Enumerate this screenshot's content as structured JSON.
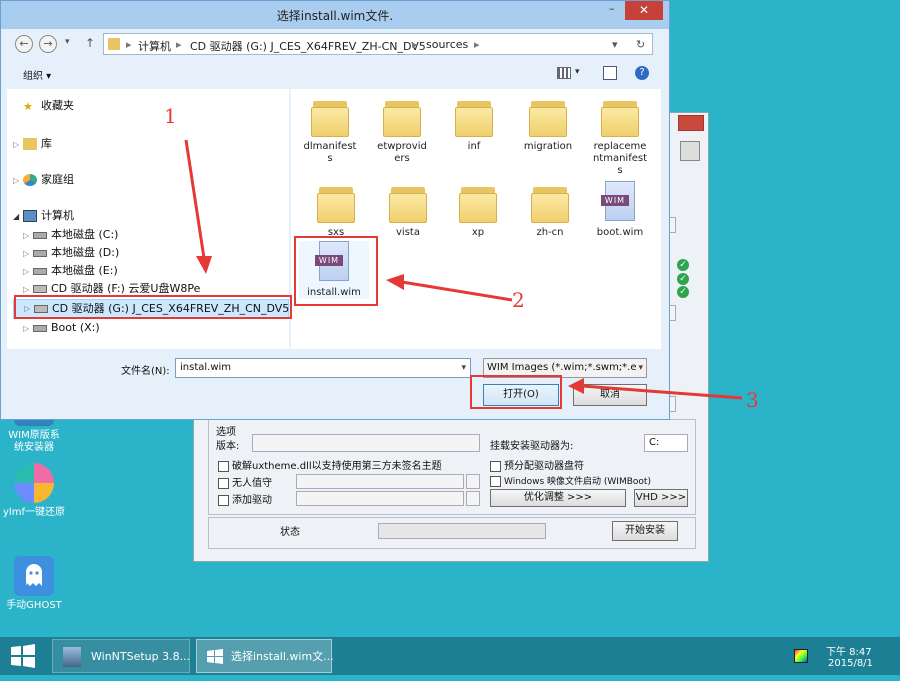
{
  "desktop": {
    "icons": [
      {
        "label_lines": [
          "WIM原版系",
          "统安装器"
        ]
      },
      {
        "label": "ylmf一键还原"
      },
      {
        "label": "手动GHOST"
      }
    ]
  },
  "setup_window": {
    "options_label": "选项",
    "version_label": "版本:",
    "cb1": "破解uxtheme.dll以支持使用第三方未签名主题",
    "cb2": "无人值守",
    "cb3": "添加驱动",
    "mount_label": "挂载安装驱动器为:",
    "mount_value": "C:",
    "cb4": "预分配驱动器盘符",
    "cb5": "Windows 映像文件启动 (WIMBoot)",
    "optimize_button": "优化调整 >>>",
    "vhd_button": "VHD >>>",
    "status_label": "状态",
    "install_button": "开始安装"
  },
  "dialog": {
    "title": "选择install.wim文件.",
    "close_glyph": "✕",
    "minimize_glyph": "–",
    "back_glyph": "←",
    "forward_glyph": "→",
    "dropdown_glyph": "▾",
    "up_glyph": "↑",
    "refresh_glyph": "↻",
    "breadcrumb": [
      "计算机",
      "CD 驱动器 (G:) J_CES_X64FREV_ZH-CN_DV5",
      "sources"
    ],
    "organize_label": "组织 ▾",
    "nav_items": [
      {
        "label": "收藏夹",
        "icon": "star-icon"
      },
      {
        "label": "库",
        "icon": "library-icon"
      },
      {
        "label": "家庭组",
        "icon": "homegroup-icon"
      },
      {
        "label": "计算机",
        "icon": "computer-icon"
      },
      {
        "label": "本地磁盘 (C:)",
        "icon": "drive-icon"
      },
      {
        "label": "本地磁盘 (D:)",
        "icon": "drive-icon"
      },
      {
        "label": "本地磁盘 (E:)",
        "icon": "drive-icon"
      },
      {
        "label": "CD 驱动器 (F:) 云爱U盘W8Pe",
        "icon": "cd-drive-icon"
      },
      {
        "label": "CD 驱动器 (G:) J_CES_X64FREV_ZH_CN_DV5",
        "icon": "cd-drive-icon"
      },
      {
        "label": "Boot (X:)",
        "icon": "drive-icon"
      }
    ],
    "files": [
      {
        "label_lines": [
          "dlmanifest",
          "s"
        ],
        "type": "folder"
      },
      {
        "label_lines": [
          "etwprovid",
          "ers"
        ],
        "type": "folder"
      },
      {
        "label": "inf",
        "type": "folder"
      },
      {
        "label": "migration",
        "type": "folder"
      },
      {
        "label_lines": [
          "replaceme",
          "ntmanifest",
          "s"
        ],
        "type": "folder"
      },
      {
        "label": "sxs",
        "type": "folder"
      },
      {
        "label": "vista",
        "type": "folder"
      },
      {
        "label": "xp",
        "type": "folder"
      },
      {
        "label": "zh-cn",
        "type": "folder"
      },
      {
        "label": "boot.wim",
        "type": "wim"
      },
      {
        "label": "install.wim",
        "type": "wim"
      }
    ],
    "wim_badge": "WIM",
    "filename_label": "文件名(N):",
    "filename_value": "instal.wim",
    "filetype_value": "WIM Images (*.wim;*.swm;*.e",
    "open_button": "打开(O)",
    "cancel_button": "取消"
  },
  "annotations": {
    "a1": "1",
    "a2": "2",
    "a3": "3"
  },
  "taskbar": {
    "items": [
      "WinNTSetup 3.8...",
      "选择install.wim文..."
    ],
    "time": "下午 8:47",
    "date": "2015/8/1"
  }
}
